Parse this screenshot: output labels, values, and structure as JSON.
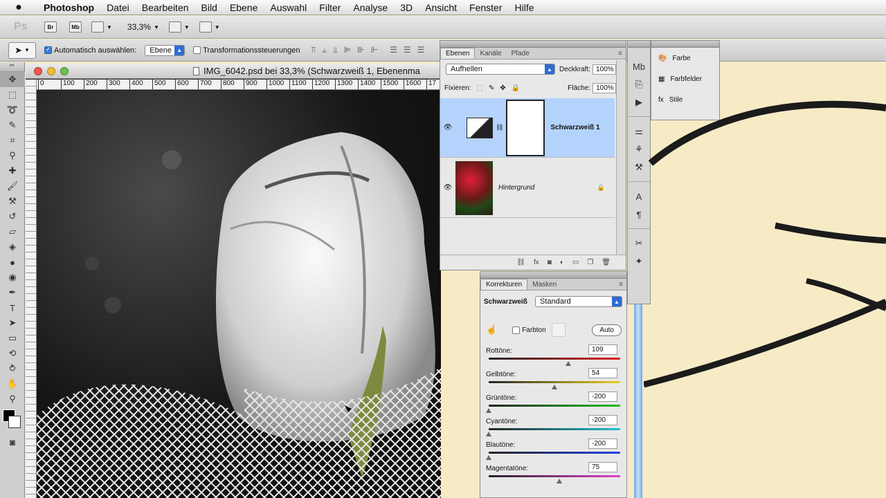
{
  "menubar": {
    "app": "Photoshop",
    "items": [
      "Datei",
      "Bearbeiten",
      "Bild",
      "Ebene",
      "Auswahl",
      "Filter",
      "Analyse",
      "3D",
      "Ansicht",
      "Fenster",
      "Hilfe"
    ]
  },
  "appbar": {
    "ps": "Ps",
    "br": "Br",
    "mb": "Mb",
    "zoom": "33,3%"
  },
  "options": {
    "auto_select_label": "Automatisch auswählen:",
    "auto_select_checked": true,
    "auto_select_value": "Ebene",
    "transform_label": "Transformationssteuerungen",
    "transform_checked": false
  },
  "document": {
    "title": "IMG_6042.psd bei 33,3% (Schwarzweiß 1, Ebenenma",
    "ruler_ticks": [
      "0",
      "100",
      "200",
      "300",
      "400",
      "500",
      "600",
      "700",
      "800",
      "900",
      "1000",
      "1100",
      "1200",
      "1300",
      "1400",
      "1500",
      "1600",
      "17"
    ]
  },
  "layers_panel": {
    "tabs": [
      "Ebenen",
      "Kanäle",
      "Pfade"
    ],
    "active_tab": "Ebenen",
    "blend_mode": "Aufhellen",
    "opacity_label": "Deckkraft:",
    "opacity": "100%",
    "lock_label": "Fixieren:",
    "fill_label": "Fläche:",
    "fill": "100%",
    "layers": [
      {
        "name": "Schwarzweiß 1",
        "selected": true,
        "visible": true
      },
      {
        "name": "Hintergrund",
        "selected": false,
        "visible": true,
        "locked": true
      }
    ]
  },
  "adjustments_panel": {
    "tabs": [
      "Korrekturen",
      "Masken"
    ],
    "active_tab": "Korrekturen",
    "title": "Schwarzweiß",
    "preset": "Standard",
    "tint_label": "Farbton",
    "tint_checked": false,
    "auto_label": "Auto",
    "sliders": [
      {
        "label": "Rottöne:",
        "value": "109",
        "gradient": "linear-gradient(90deg,#222,#e02020)",
        "level": 0.62
      },
      {
        "label": "Gelbtöne:",
        "value": "54",
        "gradient": "linear-gradient(90deg,#222,#e8d020)",
        "level": 0.51
      },
      {
        "label": "Grüntöne:",
        "value": "-200",
        "gradient": "linear-gradient(90deg,#222,#20c020)",
        "level": 0.0
      },
      {
        "label": "Cyantöne:",
        "value": "-200",
        "gradient": "linear-gradient(90deg,#222,#20c0d0)",
        "level": 0.0
      },
      {
        "label": "Blautöne:",
        "value": "-200",
        "gradient": "linear-gradient(90deg,#222,#2040e0)",
        "level": 0.0
      },
      {
        "label": "Magentatöne:",
        "value": "75",
        "gradient": "linear-gradient(90deg,#222,#e040d0)",
        "level": 0.55
      }
    ]
  },
  "flyout": {
    "items": [
      "Farbe",
      "Farbfelder",
      "Stile"
    ]
  }
}
